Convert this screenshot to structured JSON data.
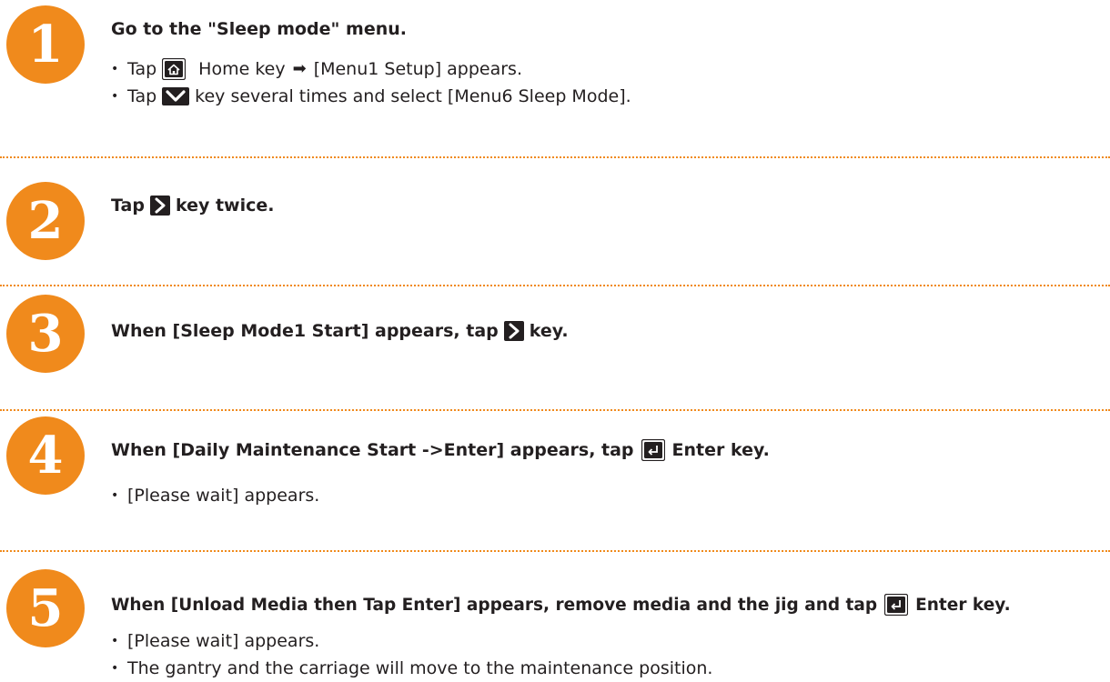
{
  "steps": [
    {
      "number": "1",
      "heading": "Go to the \"Sleep mode\" menu.",
      "bullets": {
        "b1_tap": "Tap",
        "b1_rest_a": "Home key",
        "b1_rest_b": "[Menu1 Setup] appears.",
        "b2_tap": "Tap",
        "b2_rest": "key several times and select [Menu6 Sleep Mode]."
      }
    },
    {
      "number": "2",
      "heading_a": "Tap",
      "heading_b": "key twice."
    },
    {
      "number": "3",
      "heading_a": "When [Sleep Mode1  Start] appears, tap",
      "heading_b": "key."
    },
    {
      "number": "4",
      "heading_a": "When [Daily Maintenance  Start ->Enter] appears, tap",
      "heading_b": "Enter key.",
      "bullets": [
        "[Please wait] appears."
      ]
    },
    {
      "number": "5",
      "heading_a": "When [Unload Media then Tap Enter] appears, remove media and the jig and tap",
      "heading_b": "Enter key.",
      "bullets": [
        "[Please wait] appears.",
        "The gantry and the carriage will move to the maintenance position."
      ]
    }
  ],
  "icons": {
    "home": "home-key-icon",
    "down": "down-key-icon",
    "right": "right-key-icon",
    "enter": "enter-key-icon",
    "arrow": "right-arrow-icon"
  },
  "colors": {
    "accent": "#f08a1c",
    "text": "#231f20"
  }
}
